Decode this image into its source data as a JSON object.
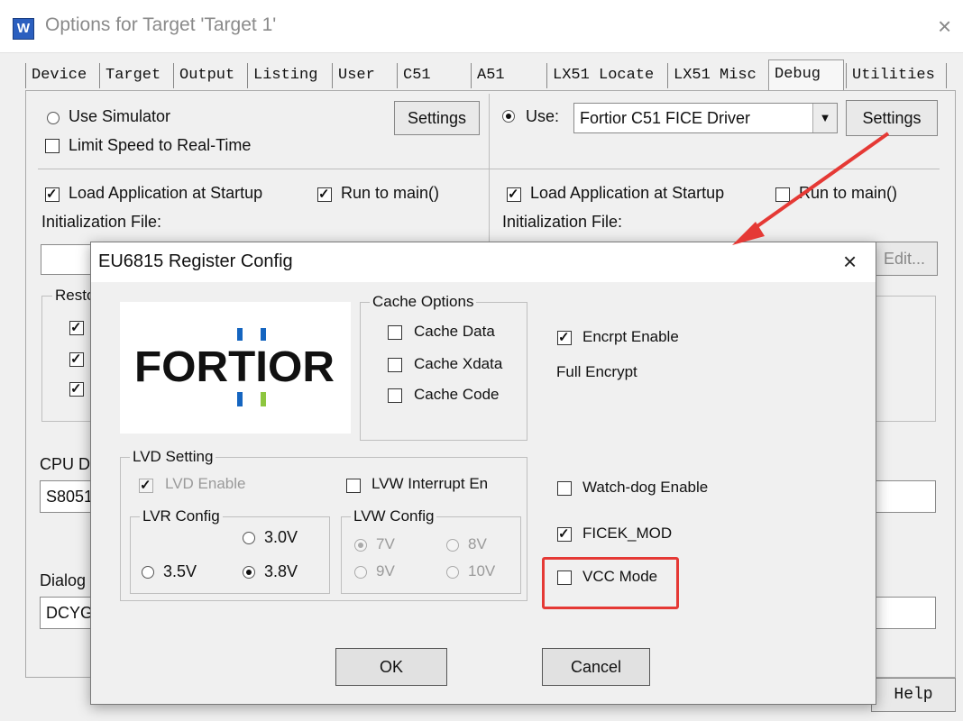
{
  "window": {
    "title": "Options for Target 'Target 1'",
    "icon": "uvision-app-icon",
    "icon_glyph": "W",
    "close_glyph": "×"
  },
  "tabs": [
    {
      "label": "Device"
    },
    {
      "label": "Target"
    },
    {
      "label": "Output"
    },
    {
      "label": "Listing"
    },
    {
      "label": "User"
    },
    {
      "label": "C51"
    },
    {
      "label": "A51"
    },
    {
      "label": "LX51 Locate"
    },
    {
      "label": "LX51 Misc"
    },
    {
      "label": "Debug",
      "active": true
    },
    {
      "label": "Utilities"
    }
  ],
  "debug": {
    "left": {
      "use_simulator_label": "Use Simulator",
      "use_simulator_selected": false,
      "limit_speed_label": "Limit Speed to Real-Time",
      "limit_speed_checked": false,
      "settings_label": "Settings",
      "load_app_label": "Load Application at Startup",
      "load_app_checked": true,
      "run_to_main_label": "Run to main()",
      "run_to_main_checked": true,
      "init_file_label": "Initialization File:",
      "restore_label": "Resto",
      "cpu_dll_label": "CPU D",
      "cpu_dll_value": "S8051",
      "dialog_dll_label": "Dialog",
      "dialog_dll_value": "DCYG"
    },
    "right": {
      "use_label": "Use:",
      "use_selected": true,
      "driver_value": "Fortior C51 FICE Driver",
      "settings_label": "Settings",
      "load_app_label": "Load Application at Startup",
      "load_app_checked": true,
      "run_to_main_label": "Run to main()",
      "run_to_main_checked": false,
      "init_file_label": "Initialization File:",
      "edit_label": "Edit..."
    },
    "help_label": "Help"
  },
  "register_dialog": {
    "title": "EU6815 Register Config",
    "close_glyph": "×",
    "logo_text": "FORTIOR",
    "logo_colors": {
      "text": "#111111",
      "blue": "#1565c0",
      "green": "#8dc63f"
    },
    "cache_options": {
      "title": "Cache Options",
      "items": [
        {
          "label": "Cache Data",
          "checked": false
        },
        {
          "label": "Cache Xdata",
          "checked": false
        },
        {
          "label": "Cache Code",
          "checked": false
        }
      ]
    },
    "encrypt_enable": {
      "label": "Encrpt Enable",
      "checked": true
    },
    "full_encrypt_label": "Full Encrypt",
    "lvd_setting": {
      "title": "LVD Setting",
      "lvd_enable": {
        "label": "LVD Enable",
        "checked": true,
        "disabled": true
      },
      "lvw_interrupt": {
        "label": "LVW Interrupt En",
        "checked": false
      },
      "lvr_config": {
        "title": "LVR Config",
        "options": [
          {
            "label": "3.0V",
            "selected": false
          },
          {
            "label": "3.5V",
            "selected": false
          },
          {
            "label": "3.8V",
            "selected": true
          }
        ]
      },
      "lvw_config": {
        "title": "LVW Config",
        "options": [
          {
            "label": "7V",
            "selected": true,
            "disabled": true
          },
          {
            "label": "8V",
            "selected": false,
            "disabled": true
          },
          {
            "label": "9V",
            "selected": false,
            "disabled": true
          },
          {
            "label": "10V",
            "selected": false,
            "disabled": true
          }
        ]
      }
    },
    "watchdog": {
      "label": "Watch-dog Enable",
      "checked": false
    },
    "ficek_mod": {
      "label": "FICEK_MOD",
      "checked": true
    },
    "vcc_mode": {
      "label": "VCC Mode",
      "checked": false
    },
    "ok_label": "OK",
    "cancel_label": "Cancel"
  },
  "annotations": {
    "arrow_color": "#e53935",
    "highlight_color": "#e53935"
  }
}
